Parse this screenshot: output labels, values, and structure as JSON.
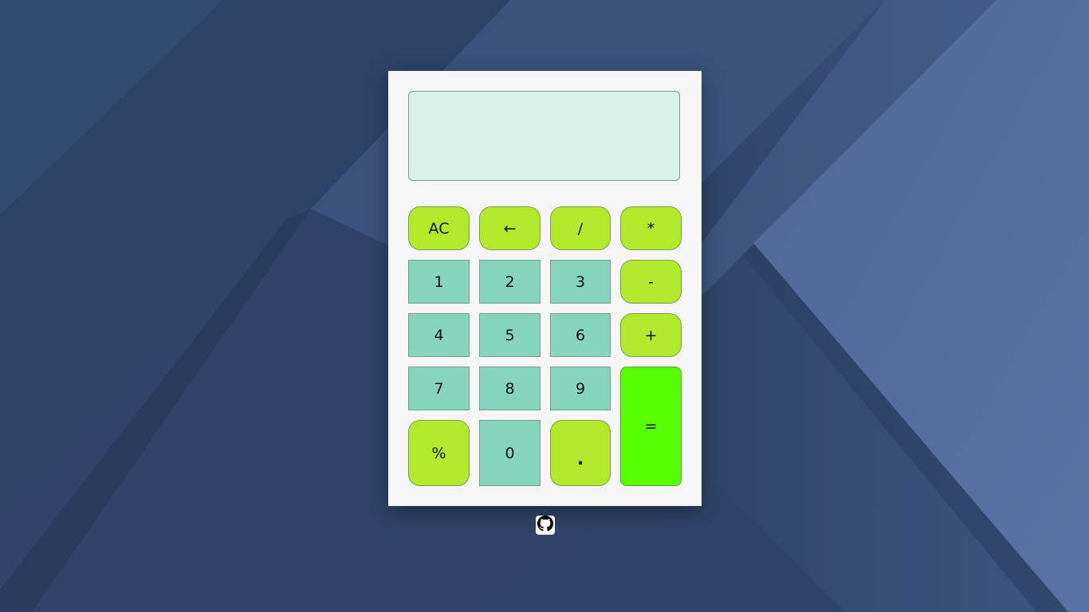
{
  "app": {
    "display_value": ""
  },
  "keys": {
    "ac": "AC",
    "backspace": "←",
    "divide": "/",
    "multiply": "*",
    "one": "1",
    "two": "2",
    "three": "3",
    "minus": "-",
    "four": "4",
    "five": "5",
    "six": "6",
    "plus": "+",
    "seven": "7",
    "eight": "8",
    "nine": "9",
    "equals": "=",
    "percent": "%",
    "zero": "0",
    "dot": "."
  },
  "footer": {
    "icon": "github-icon"
  },
  "colors": {
    "operator_key": "#b2ea2b",
    "number_key": "#85d4bd",
    "equals_key": "#58ff03",
    "display_bg": "#daf1e9",
    "panel_bg": "#f5f5f5"
  }
}
